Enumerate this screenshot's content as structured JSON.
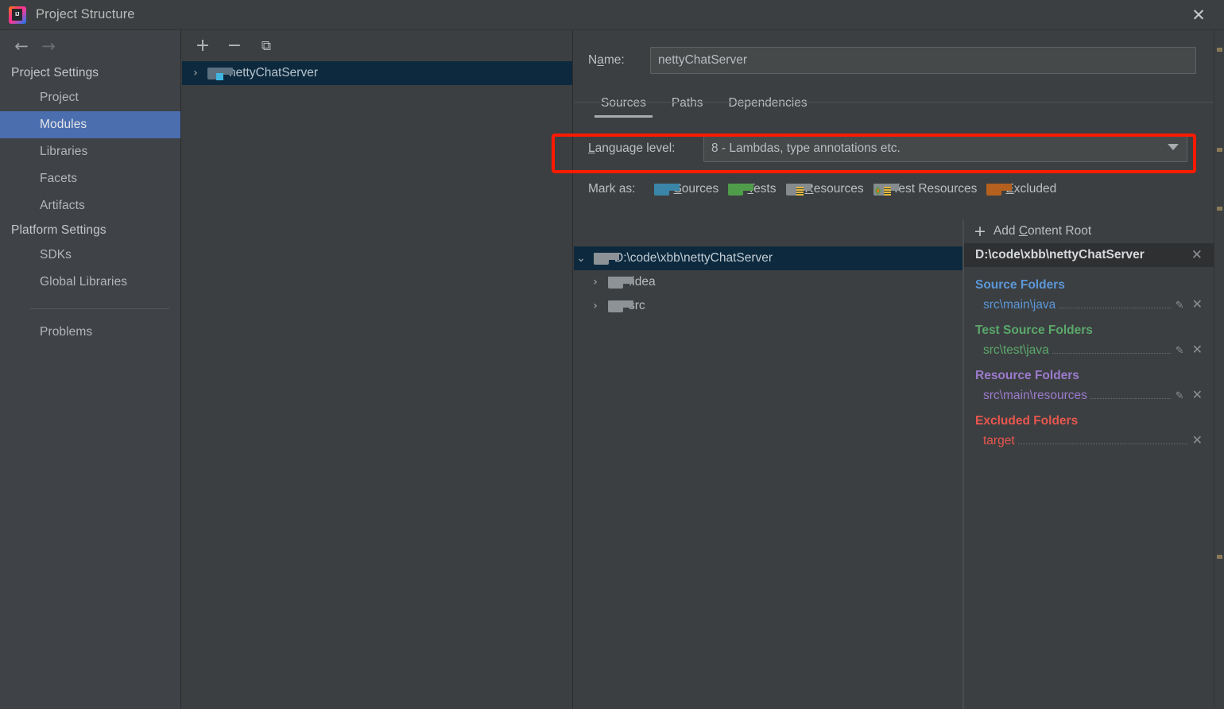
{
  "window": {
    "title": "Project Structure",
    "logo_text": "IJ",
    "close_label": "✕"
  },
  "sidebar": {
    "nav": {
      "back": "←",
      "forward": "→"
    },
    "groups": [
      {
        "label": "Project Settings",
        "items": [
          {
            "label": "Project",
            "selected": false
          },
          {
            "label": "Modules",
            "selected": true
          },
          {
            "label": "Libraries",
            "selected": false
          },
          {
            "label": "Facets",
            "selected": false
          },
          {
            "label": "Artifacts",
            "selected": false
          }
        ]
      },
      {
        "label": "Platform Settings",
        "items": [
          {
            "label": "SDKs",
            "selected": false
          },
          {
            "label": "Global Libraries",
            "selected": false
          }
        ]
      }
    ],
    "problems_label": "Problems"
  },
  "modules_panel": {
    "toolbar": {
      "add": "+",
      "remove": "−",
      "copy": "⧉"
    },
    "tree": [
      {
        "label": "nettyChatServer",
        "expander": "›",
        "selected": true
      }
    ]
  },
  "main": {
    "name_label_pre": "N",
    "name_label_mnemonic": "a",
    "name_label_post": "me:",
    "name_value": "nettyChatServer",
    "tabs": [
      {
        "label": "Sources",
        "active": true
      },
      {
        "label": "Paths",
        "active": false
      },
      {
        "label": "Dependencies",
        "active": false
      }
    ],
    "language_level": {
      "label_mnemonic": "L",
      "label_post": "anguage level:",
      "value": "8 - Lambdas, type annotations etc."
    },
    "mark_as": {
      "label": "Mark as:",
      "options": [
        {
          "label_mnemonic": "S",
          "label_post": "ources",
          "icon": "folder-blue-icon",
          "color": "#3b86a8"
        },
        {
          "label_mnemonic": "T",
          "label_post": "ests",
          "icon": "folder-green-icon",
          "color": "#4f9d4a"
        },
        {
          "label_mnemonic": "R",
          "label_post": "esources",
          "icon": "folder-resources-icon",
          "color": "#868b8e"
        },
        {
          "label_mnemonic": "",
          "label_post": "Test Resources",
          "icon": "folder-test-resources-icon",
          "color": "#868b8e"
        },
        {
          "label_mnemonic": "E",
          "label_post": "xcluded",
          "icon": "folder-orange-icon",
          "color": "#b5601f"
        }
      ]
    },
    "file_tree": [
      {
        "label": "D:\\code\\xbb\\nettyChatServer",
        "expander": "⌄",
        "indent": 0,
        "selected": true
      },
      {
        "label": ".idea",
        "expander": "›",
        "indent": 1,
        "selected": false
      },
      {
        "label": "src",
        "expander": "›",
        "indent": 1,
        "selected": false
      }
    ]
  },
  "content_root_panel": {
    "add_content_root": {
      "plus": "+",
      "pre": "Add ",
      "mnemonic": "C",
      "post": "ontent Root"
    },
    "root_path": "D:\\code\\xbb\\nettyChatServer",
    "root_close": "✕",
    "groups": [
      {
        "title": "Source Folders",
        "kind": "src",
        "color": "#5b97d9",
        "items": [
          {
            "path": "src\\main\\java",
            "has_edit": true,
            "edit": "✎",
            "remove": "✕"
          }
        ]
      },
      {
        "title": "Test Source Folders",
        "kind": "test",
        "color": "#5aa86b",
        "items": [
          {
            "path": "src\\test\\java",
            "has_edit": true,
            "edit": "✎",
            "remove": "✕"
          }
        ]
      },
      {
        "title": "Resource Folders",
        "kind": "res",
        "color": "#9b7bcc",
        "items": [
          {
            "path": "src\\main\\resources",
            "has_edit": true,
            "edit": "✎",
            "remove": "✕"
          }
        ]
      },
      {
        "title": "Excluded Folders",
        "kind": "exc",
        "color": "#e8564e",
        "items": [
          {
            "path": "target",
            "has_edit": false,
            "edit": "",
            "remove": "✕"
          }
        ]
      }
    ]
  },
  "annotation": {
    "type": "red-rectangle-highlight",
    "color": "#ff1a00",
    "target": "language-level-row"
  },
  "theme": {
    "background": "#3c3f41",
    "sidebar_background": "#3f4246",
    "selection_blue": "#4b6eaf",
    "tree_selection": "#0d293e",
    "text": "#bcbfc2"
  }
}
